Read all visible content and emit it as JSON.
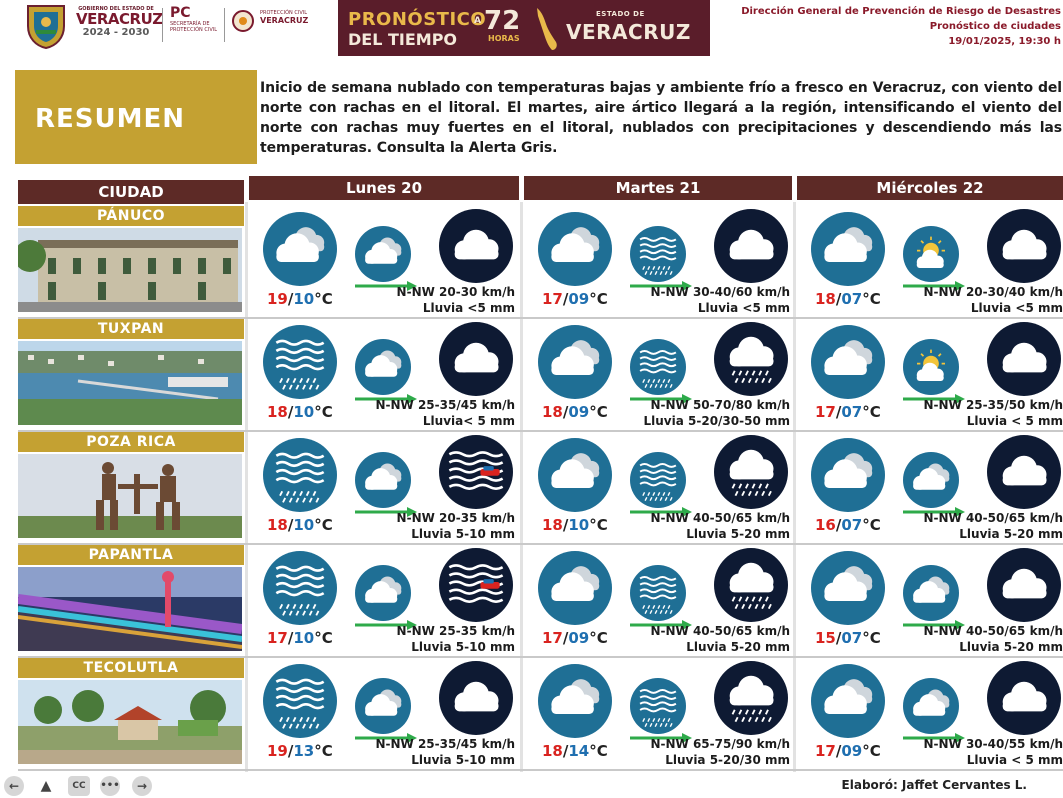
{
  "header": {
    "gov_small": "GOBIERNO DEL ESTADO DE",
    "gov_name": "VERACRUZ",
    "gov_years": "2024 - 2030",
    "pc_big": "PC",
    "pc_small": "SECRETARÍA DE PROTECCIÓN CIVIL",
    "ver_small1": "PROTECCIÓN CIVIL",
    "ver_small2": "VERACRUZ",
    "banner_line1": "PRONÓSTICO",
    "banner_line2": "DEL TIEMPO",
    "banner_a": "A",
    "banner_72": "72",
    "banner_horas": "HORAS",
    "banner_estado": "ESTADO DE",
    "banner_state": "VERACRUZ",
    "dept_line1": "Dirección General de Prevención de Riesgo de Desastres",
    "dept_line2": "Pronóstico de ciudades",
    "dept_line3": "19/01/2025, 19:30 h"
  },
  "summary": {
    "title": "RESUMEN",
    "body": "Inicio de semana nublado con temperaturas bajas y ambiente frío a fresco en Veracruz, con viento del norte con rachas en el litoral. El martes, aire ártico llegará a la región, intensificando el viento del norte con rachas muy fuertes en el litoral, nublados con precipitaciones y descendiendo más las temperaturas. Consulta la Alerta Gris."
  },
  "table": {
    "city_header": "CIUDAD",
    "days": [
      "Lunes 20",
      "Martes 21",
      "Miércoles 22"
    ],
    "unit": "°C",
    "cities": [
      {
        "name": "PÁNUCO",
        "forecast": [
          {
            "tmax": "19",
            "tmin": "10",
            "wind": "N-NW 20-30 km/h",
            "rain": "Lluvia <5 mm",
            "day_icon": "cloudy-icon",
            "mid_icon": "cloudy-icon",
            "night_icon": "night-cloudy-icon"
          },
          {
            "tmax": "17",
            "tmin": "09",
            "wind": "N-NW 30-40/60 km/h",
            "rain": "Lluvia <5 mm",
            "day_icon": "cloudy-icon",
            "mid_icon": "rain-icon",
            "night_icon": "night-cloudy-icon"
          },
          {
            "tmax": "18",
            "tmin": "07",
            "wind": "N-NW 20-30/40 km/h",
            "rain": "Lluvia <5 mm",
            "day_icon": "cloudy-icon",
            "mid_icon": "partly-sunny-icon",
            "night_icon": "night-cloudy-icon"
          }
        ]
      },
      {
        "name": "TUXPAN",
        "forecast": [
          {
            "tmax": "18",
            "tmin": "10",
            "wind": "N-NW 25-35/45 km/h",
            "rain": "Lluvia< 5 mm",
            "day_icon": "rain-icon",
            "mid_icon": "cloudy-icon",
            "night_icon": "night-cloudy-icon"
          },
          {
            "tmax": "18",
            "tmin": "09",
            "wind": "N-NW 50-70/80 km/h",
            "rain": "Lluvia 5-20/30-50 mm",
            "day_icon": "cloudy-icon",
            "mid_icon": "rain-icon",
            "night_icon": "night-rain-icon"
          },
          {
            "tmax": "17",
            "tmin": "07",
            "wind": "N-NW 25-35/50 km/h",
            "rain": "Lluvia < 5 mm",
            "day_icon": "cloudy-icon",
            "mid_icon": "partly-sunny-icon",
            "night_icon": "night-cloudy-icon"
          }
        ]
      },
      {
        "name": "POZA RICA",
        "forecast": [
          {
            "tmax": "18",
            "tmin": "10",
            "wind": "N-NW 20-35 km/h",
            "rain": "Lluvia 5-10 mm",
            "day_icon": "rain-icon",
            "mid_icon": "cloudy-icon",
            "night_icon": "night-wind-icon"
          },
          {
            "tmax": "18",
            "tmin": "10",
            "wind": "N-NW 40-50/65 km/h",
            "rain": "Lluvia 5-20 mm",
            "day_icon": "cloudy-icon",
            "mid_icon": "rain-icon",
            "night_icon": "night-rain-icon"
          },
          {
            "tmax": "16",
            "tmin": "07",
            "wind": "N-NW 40-50/65 km/h",
            "rain": "Lluvia 5-20 mm",
            "day_icon": "cloudy-icon",
            "mid_icon": "cloudy-icon",
            "night_icon": "night-cloudy-icon"
          }
        ]
      },
      {
        "name": "PAPANTLA",
        "forecast": [
          {
            "tmax": "17",
            "tmin": "10",
            "wind": "N-NW 25-35 km/h",
            "rain": "Lluvia 5-10 mm",
            "day_icon": "rain-icon",
            "mid_icon": "cloudy-icon",
            "night_icon": "night-wind-icon"
          },
          {
            "tmax": "17",
            "tmin": "09",
            "wind": "N-NW 40-50/65 km/h",
            "rain": "Lluvia 5-20 mm",
            "day_icon": "cloudy-icon",
            "mid_icon": "rain-icon",
            "night_icon": "night-rain-icon"
          },
          {
            "tmax": "15",
            "tmin": "07",
            "wind": "N-NW 40-50/65 km/h",
            "rain": "Lluvia 5-20 mm",
            "day_icon": "cloudy-icon",
            "mid_icon": "cloudy-icon",
            "night_icon": "night-cloudy-icon"
          }
        ]
      },
      {
        "name": "TECOLUTLA",
        "forecast": [
          {
            "tmax": "19",
            "tmin": "13",
            "wind": "N-NW 25-35/45 km/h",
            "rain": "Lluvia 5-10 mm",
            "day_icon": "rain-icon",
            "mid_icon": "cloudy-icon",
            "night_icon": "night-cloudy-icon"
          },
          {
            "tmax": "18",
            "tmin": "14",
            "wind": "N-NW 65-75/90 km/h",
            "rain": "Lluvia 5-20/30 mm",
            "day_icon": "cloudy-icon",
            "mid_icon": "rain-icon",
            "night_icon": "night-rain-icon"
          },
          {
            "tmax": "17",
            "tmin": "09",
            "wind": "N-NW 30-40/55 km/h",
            "rain": "Lluvia < 5 mm",
            "day_icon": "cloudy-icon",
            "mid_icon": "cloudy-icon",
            "night_icon": "night-cloudy-icon"
          }
        ]
      }
    ]
  },
  "footer": {
    "credit": "Elaboró: Jaffet Cervantes L.",
    "controls": [
      "prev-icon",
      "accessibility-icon",
      "cc-icon",
      "more-icon",
      "next-icon"
    ]
  },
  "colors": {
    "maroon": "#5d2a26",
    "gold": "#c4a132",
    "tmax": "#d9231f",
    "tmin": "#1f6fb0",
    "icon_day": "#1f6f95",
    "icon_night": "#0e1a33",
    "arrow": "#2eaa4a"
  }
}
